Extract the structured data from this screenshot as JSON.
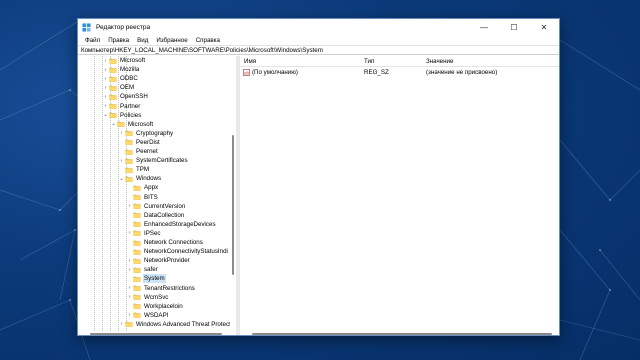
{
  "window": {
    "title": "Редактор реестра",
    "controls": {
      "minimize": "—",
      "maximize": "☐",
      "close": "✕"
    }
  },
  "menu": [
    "Файл",
    "Правка",
    "Вид",
    "Избранное",
    "Справка"
  ],
  "address": "Компьютер\\HKEY_LOCAL_MACHINE\\SOFTWARE\\Policies\\Microsoft\\Windows\\System",
  "tree": [
    {
      "label": "Microsoft",
      "level": 0,
      "expander": "collapsed"
    },
    {
      "label": "Mozilla",
      "level": 0,
      "expander": "collapsed"
    },
    {
      "label": "ODBC",
      "level": 0,
      "expander": "collapsed"
    },
    {
      "label": "OEM",
      "level": 0,
      "expander": "collapsed"
    },
    {
      "label": "OpenSSH",
      "level": 0,
      "expander": "collapsed"
    },
    {
      "label": "Partner",
      "level": 0,
      "expander": "collapsed"
    },
    {
      "label": "Policies",
      "level": 0,
      "expander": "expanded"
    },
    {
      "label": "Microsoft",
      "level": 1,
      "expander": "expanded"
    },
    {
      "label": "Cryptography",
      "level": 2,
      "expander": "collapsed"
    },
    {
      "label": "PeerDist",
      "level": 2,
      "expander": "none"
    },
    {
      "label": "Peernet",
      "level": 2,
      "expander": "none"
    },
    {
      "label": "SystemCertificates",
      "level": 2,
      "expander": "collapsed"
    },
    {
      "label": "TPM",
      "level": 2,
      "expander": "none"
    },
    {
      "label": "Windows",
      "level": 2,
      "expander": "expanded"
    },
    {
      "label": "Appx",
      "level": 3,
      "expander": "none"
    },
    {
      "label": "BITS",
      "level": 3,
      "expander": "none"
    },
    {
      "label": "CurrentVersion",
      "level": 3,
      "expander": "collapsed"
    },
    {
      "label": "DataCollection",
      "level": 3,
      "expander": "none"
    },
    {
      "label": "EnhancedStorageDevices",
      "level": 3,
      "expander": "none"
    },
    {
      "label": "IPSec",
      "level": 3,
      "expander": "collapsed"
    },
    {
      "label": "Network Connections",
      "level": 3,
      "expander": "none"
    },
    {
      "label": "NetworkConnectivityStatusIndi",
      "level": 3,
      "expander": "none"
    },
    {
      "label": "NetworkProvider",
      "level": 3,
      "expander": "collapsed"
    },
    {
      "label": "safer",
      "level": 3,
      "expander": "collapsed"
    },
    {
      "label": "System",
      "level": 3,
      "expander": "none",
      "selected": true
    },
    {
      "label": "TenantRestrictions",
      "level": 3,
      "expander": "collapsed"
    },
    {
      "label": "WcmSvc",
      "level": 3,
      "expander": "collapsed"
    },
    {
      "label": "Workplaceloin",
      "level": 3,
      "expander": "none"
    },
    {
      "label": "WSDAPI",
      "level": 3,
      "expander": "collapsed"
    },
    {
      "label": "Windows Advanced Threat Protect",
      "level": 2,
      "expander": "collapsed"
    }
  ],
  "list": {
    "columns": {
      "name": "Имя",
      "type": "Тип",
      "data": "Значение"
    },
    "rows": [
      {
        "name": "(По умолчанию)",
        "type": "REG_SZ",
        "data": "(значение не присвоено)",
        "icon": "string-value-icon"
      }
    ]
  },
  "colors": {
    "desktop": "#0b3a7a",
    "folder": "#f2c94c",
    "selection": "#cce4f7",
    "window_border": "#6a8dc0"
  }
}
